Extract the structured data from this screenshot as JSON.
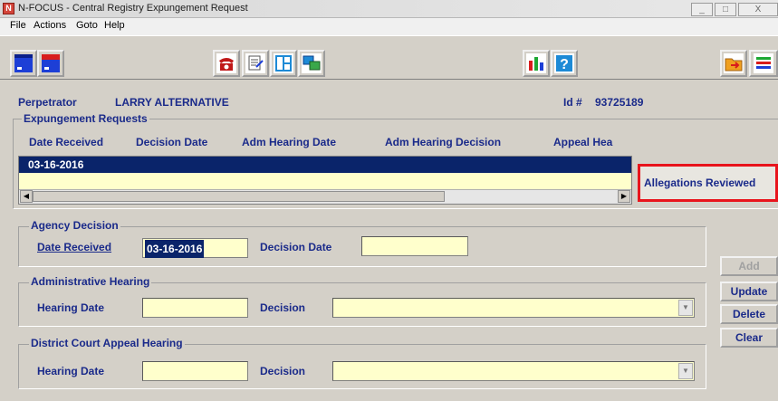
{
  "window": {
    "title": "N-FOCUS - Central Registry Expungement Request",
    "icon_letter": "N",
    "controls": [
      "_",
      "□",
      "X"
    ]
  },
  "menu": [
    "File",
    "Actions",
    "Goto",
    "Help"
  ],
  "toolbar": {
    "icons": [
      "window-icon",
      "window-red-icon",
      "phone-icon",
      "document-icon",
      "layout-icon",
      "screens-icon",
      "bar-chart-icon",
      "help-icon",
      "exit-folder-icon",
      "menu-icon"
    ]
  },
  "header": {
    "perpetrator_label": "Perpetrator",
    "perpetrator_value": "LARRY ALTERNATIVE",
    "id_label": "Id #",
    "id_value": "93725189"
  },
  "expungement": {
    "group_title": "Expungement Requests",
    "columns": [
      "Date Received",
      "Decision Date",
      "Adm Hearing Date",
      "Adm Hearing Decision",
      "Appeal Hea"
    ],
    "rows": [
      {
        "date_received": "03-16-2016"
      }
    ],
    "allegations_button": "Allegations Reviewed"
  },
  "agency_decision": {
    "group_title": "Agency Decision",
    "date_received_label": "Date Received",
    "date_received_value": "03-16-2016",
    "decision_date_label": "Decision Date",
    "decision_date_value": ""
  },
  "admin_hearing": {
    "group_title": "Administrative Hearing",
    "hearing_date_label": "Hearing Date",
    "hearing_date_value": "",
    "decision_label": "Decision",
    "decision_value": ""
  },
  "appeal_hearing": {
    "group_title": "District Court Appeal Hearing",
    "hearing_date_label": "Hearing Date",
    "hearing_date_value": "",
    "decision_label": "Decision",
    "decision_value": ""
  },
  "side_buttons": {
    "add": "Add",
    "update": "Update",
    "delete": "Delete",
    "clear": "Clear"
  },
  "colors": {
    "label_blue": "#1a2a8a",
    "field_yellow": "#ffffcc",
    "selection_navy": "#0a246a",
    "highlight_red": "#e8141c"
  }
}
